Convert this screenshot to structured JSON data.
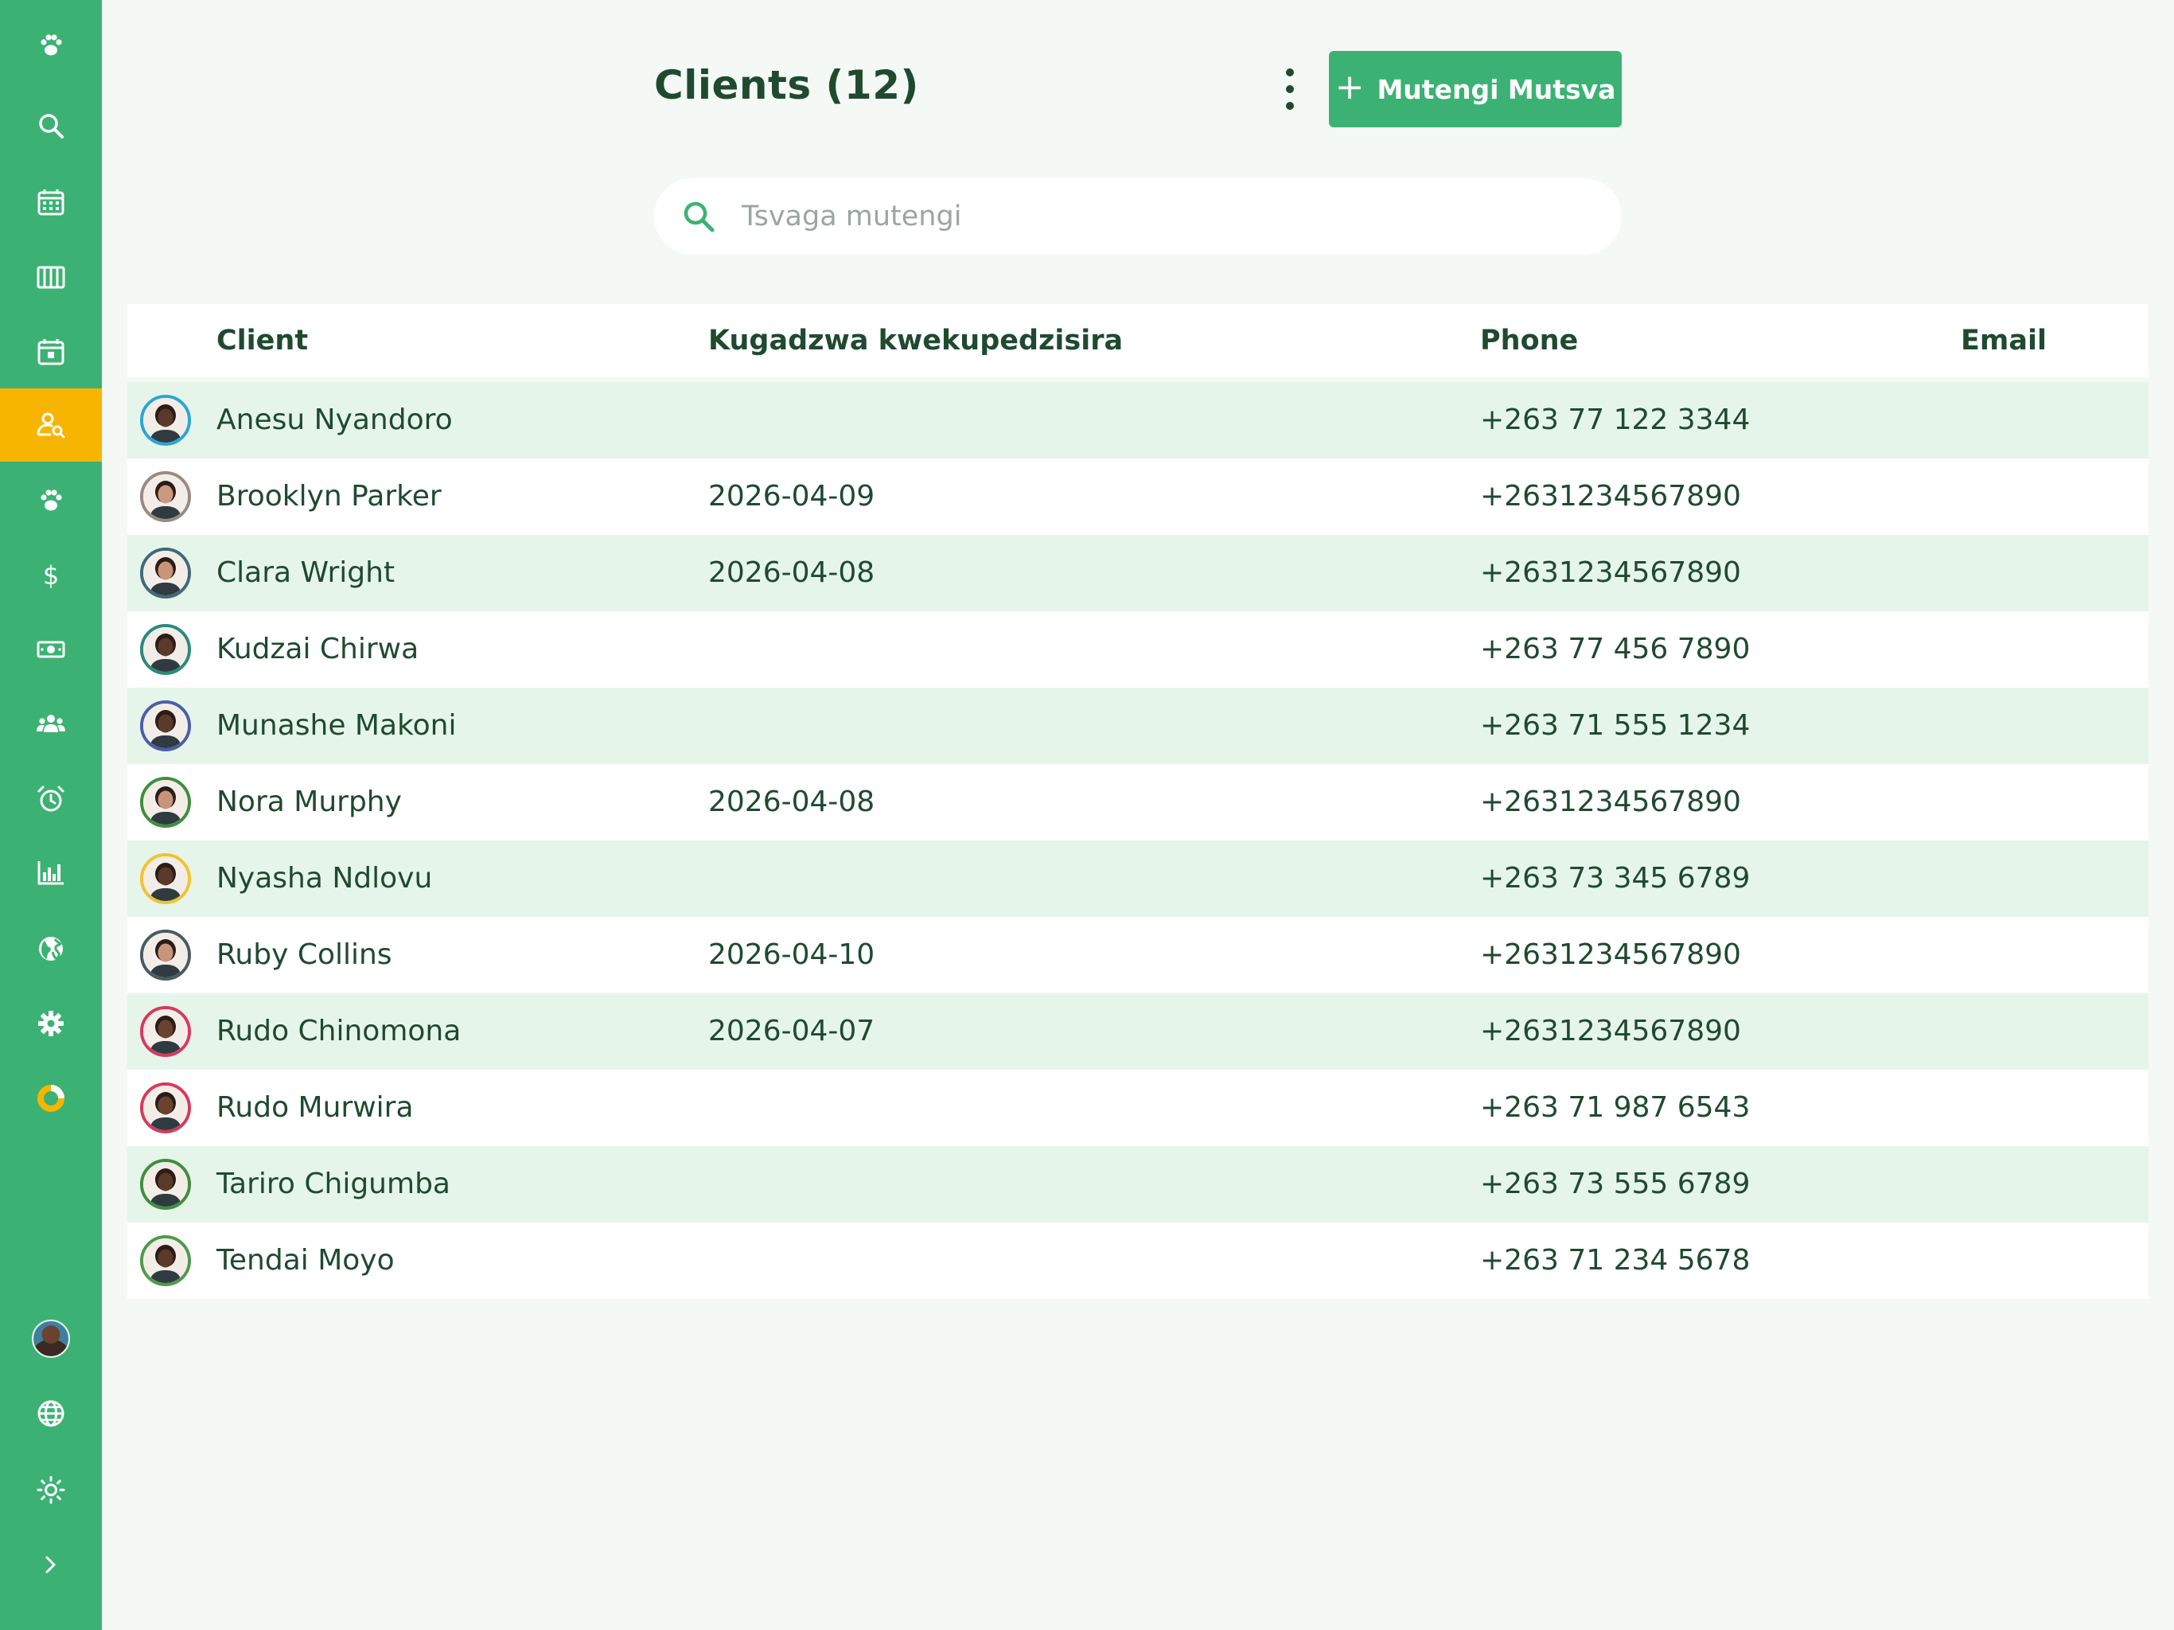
{
  "colors": {
    "primary": "#3bb273",
    "active": "#f7b500",
    "text": "#1f4a30",
    "row_alt": "#e6f5ea"
  },
  "sidebar": {
    "items": [
      {
        "icon": "paw-logo-icon"
      },
      {
        "icon": "search-icon"
      },
      {
        "icon": "calendar-grid-icon"
      },
      {
        "icon": "columns-icon"
      },
      {
        "icon": "calendar-day-icon"
      },
      {
        "icon": "client-search-icon",
        "active": true
      },
      {
        "icon": "paw-icon"
      },
      {
        "icon": "dollar-icon"
      },
      {
        "icon": "cash-icon"
      },
      {
        "icon": "users-icon"
      },
      {
        "icon": "alarm-clock-icon"
      },
      {
        "icon": "bar-chart-icon"
      },
      {
        "icon": "globe-filled-icon"
      },
      {
        "icon": "gear-icon"
      },
      {
        "icon": "donut-icon"
      }
    ],
    "bottom": [
      {
        "icon": "user-avatar"
      },
      {
        "icon": "globe-icon"
      },
      {
        "icon": "sun-icon"
      },
      {
        "icon": "chevron-right-icon"
      }
    ]
  },
  "header": {
    "title": "Clients (12)",
    "new_button_label": "Mutengi Mutsva",
    "plus": "+"
  },
  "search": {
    "placeholder": "Tsvaga mutengi",
    "value": ""
  },
  "table": {
    "columns": [
      "Client",
      "Kugadzwa kwekupedzisira",
      "Phone",
      "Email"
    ],
    "rows": [
      {
        "name": "Anesu Nyandoro",
        "date": "",
        "phone": "+263 77 122 3344",
        "email": "",
        "ring": "#2aa6d6",
        "skin": "#5a3a2a"
      },
      {
        "name": "Brooklyn Parker",
        "date": "2026-04-09",
        "phone": "+2631234567890",
        "email": "",
        "ring": "#9b8a82",
        "skin": "#c99a80"
      },
      {
        "name": "Clara Wright",
        "date": "2026-04-08",
        "phone": "+2631234567890",
        "email": "",
        "ring": "#3e6a7a",
        "skin": "#c9957a"
      },
      {
        "name": "Kudzai Chirwa",
        "date": "",
        "phone": "+263 77 456 7890",
        "email": "",
        "ring": "#2b8a7c",
        "skin": "#5a3a2a"
      },
      {
        "name": "Munashe Makoni",
        "date": "",
        "phone": "+263 71 555 1234",
        "email": "",
        "ring": "#4a5ea8",
        "skin": "#5a3a2a"
      },
      {
        "name": "Nora Murphy",
        "date": "2026-04-08",
        "phone": "+2631234567890",
        "email": "",
        "ring": "#3f8f3a",
        "skin": "#c9957a"
      },
      {
        "name": "Nyasha Ndlovu",
        "date": "",
        "phone": "+263 73 345 6789",
        "email": "",
        "ring": "#f2c230",
        "skin": "#5a3a2a"
      },
      {
        "name": "Ruby Collins",
        "date": "2026-04-10",
        "phone": "+2631234567890",
        "email": "",
        "ring": "#4a5a62",
        "skin": "#c9957a"
      },
      {
        "name": "Rudo Chinomona",
        "date": "2026-04-07",
        "phone": "+2631234567890",
        "email": "",
        "ring": "#d63a5e",
        "skin": "#6a4230"
      },
      {
        "name": "Rudo Murwira",
        "date": "",
        "phone": "+263 71 987 6543",
        "email": "",
        "ring": "#d63a5e",
        "skin": "#6a4230"
      },
      {
        "name": "Tariro Chigumba",
        "date": "",
        "phone": "+263 73 555 6789",
        "email": "",
        "ring": "#3f8f3a",
        "skin": "#5a3a2a"
      },
      {
        "name": "Tendai Moyo",
        "date": "",
        "phone": "+263 71 234 5678",
        "email": "",
        "ring": "#4f9a4a",
        "skin": "#5a3a2a"
      }
    ]
  }
}
